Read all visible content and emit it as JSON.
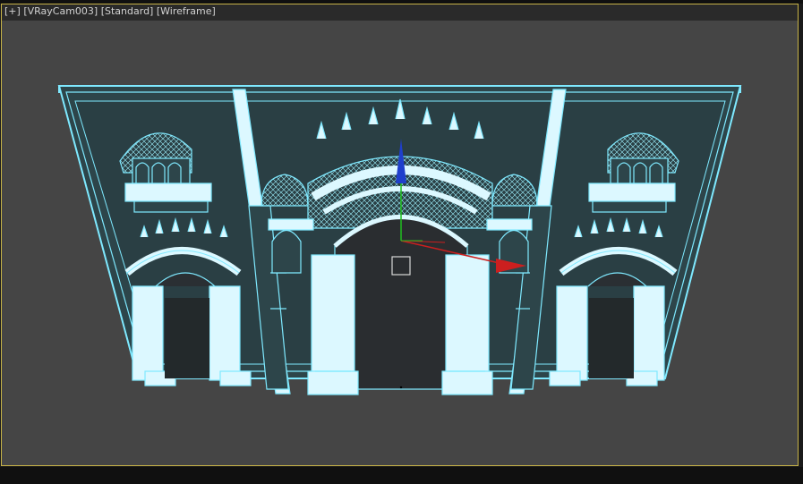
{
  "viewport": {
    "labels": {
      "plus": "[+]",
      "camera": "[VRayCam003]",
      "shading_mode": "[Standard]",
      "display_mode": "[Wireframe]"
    },
    "colors": {
      "frame_border": "#c7b347",
      "background": "#454545",
      "wire": "#7fe9ff",
      "wire_fill": "#2c454b",
      "gizmo_x": "#cc1f1f",
      "gizmo_y": "#1fbf1f",
      "gizmo_z": "#1f3fcc"
    },
    "icons": [
      "transform-gizmo-icon"
    ]
  }
}
